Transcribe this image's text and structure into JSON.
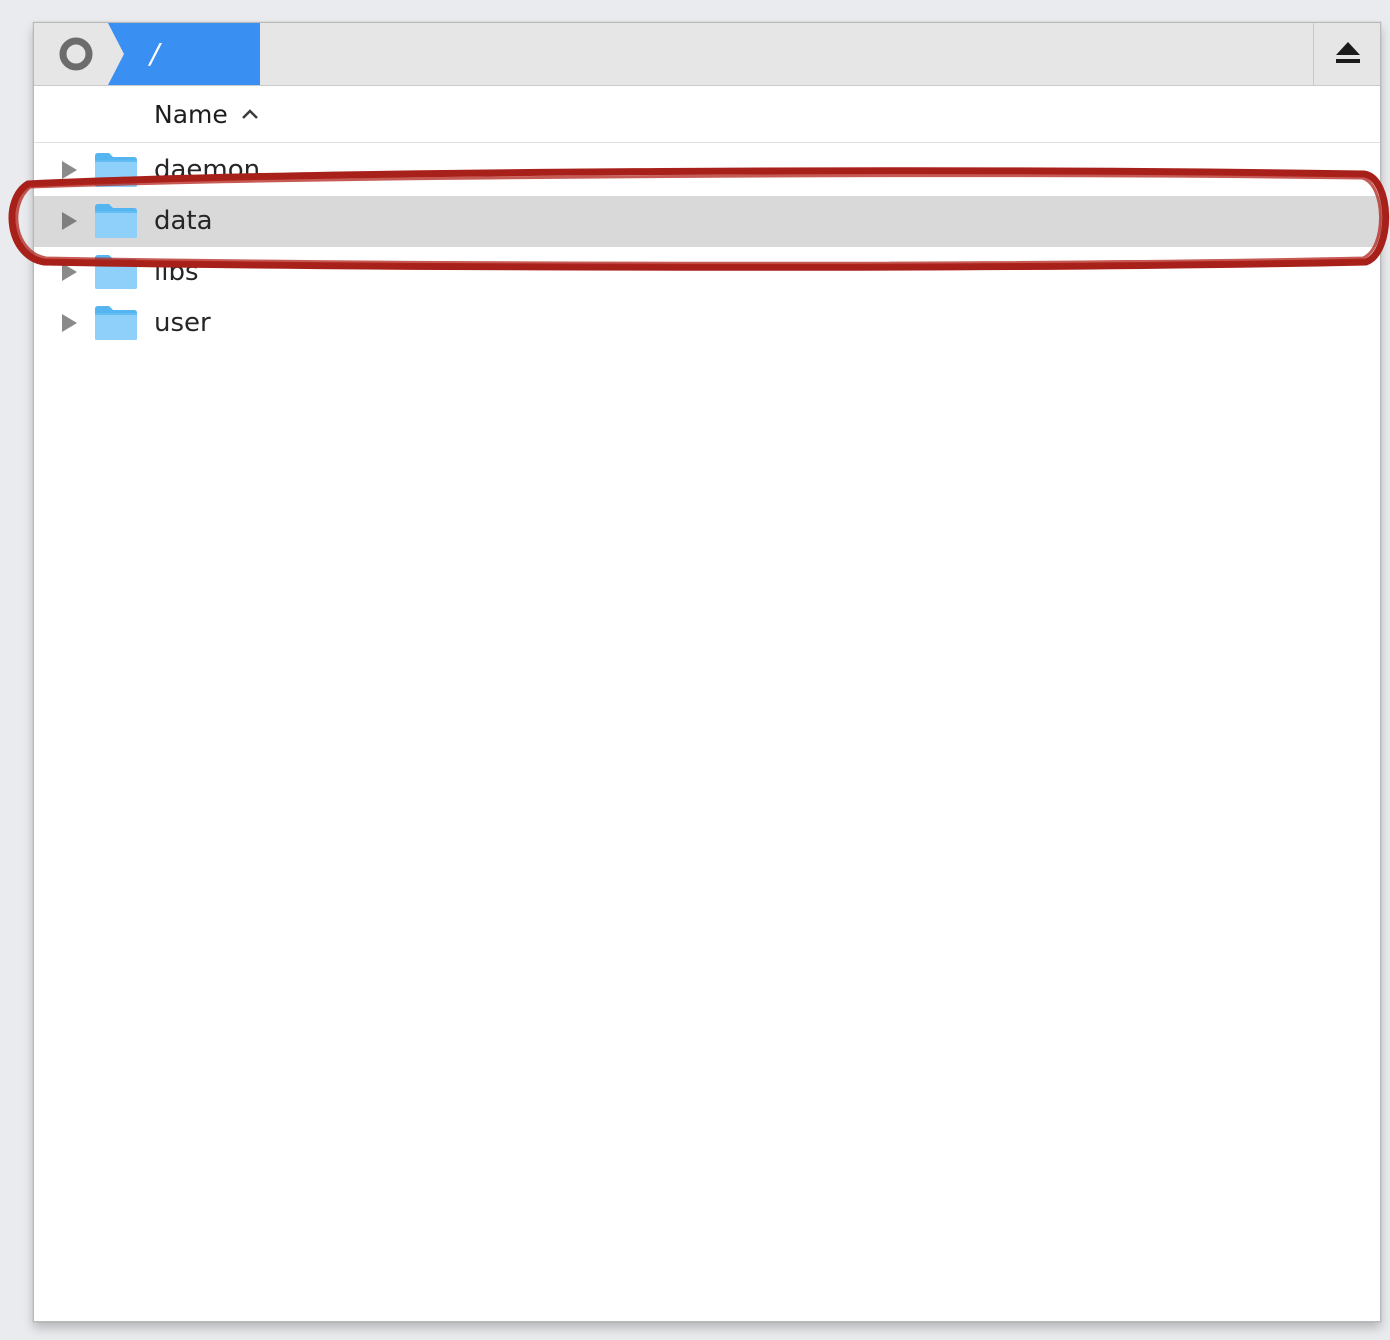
{
  "pathbar": {
    "root_icon": "disk-ring-icon",
    "crumb_label": "/",
    "eject_icon": "eject-icon",
    "accent_color": "#3a8ff2"
  },
  "header": {
    "name_label": "Name",
    "sort_icon": "chevron-up-icon"
  },
  "rows": [
    {
      "label": "daemon",
      "icon": "folder-icon",
      "selected": false
    },
    {
      "label": "data",
      "icon": "folder-icon",
      "selected": true
    },
    {
      "label": "libs",
      "icon": "folder-icon",
      "selected": false
    },
    {
      "label": "user",
      "icon": "folder-icon",
      "selected": false
    }
  ],
  "annotation": {
    "color": "#a8201a"
  }
}
